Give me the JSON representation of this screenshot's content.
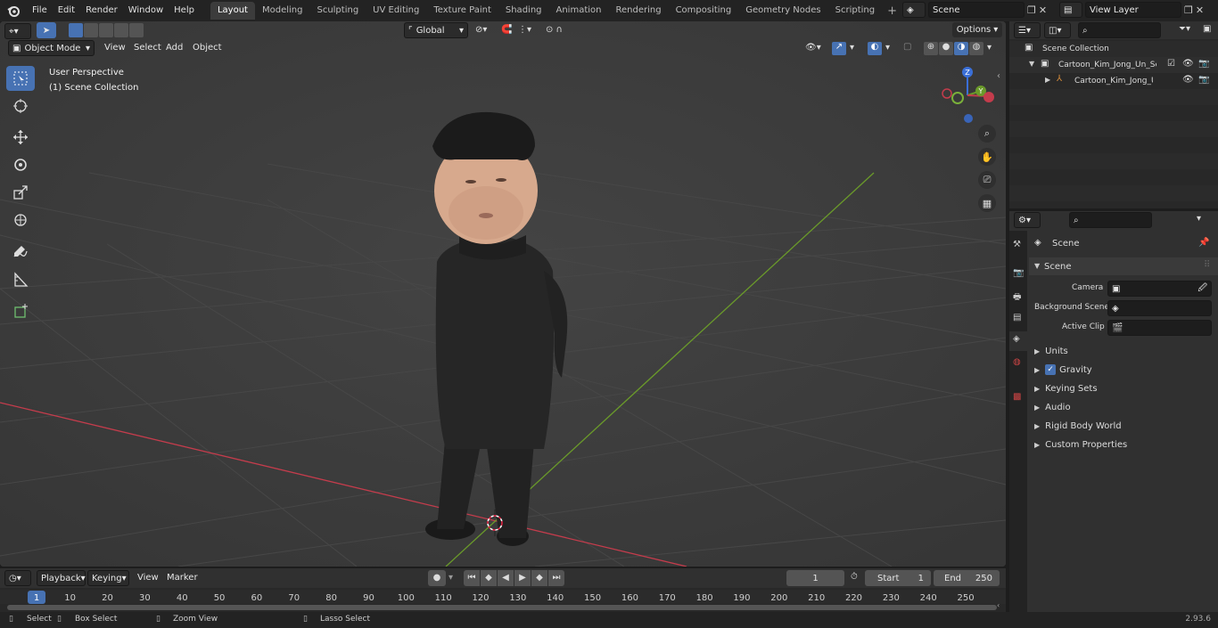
{
  "menubar": {
    "items": [
      "File",
      "Edit",
      "Render",
      "Window",
      "Help"
    ],
    "workspaces": [
      "Layout",
      "Modeling",
      "Sculpting",
      "UV Editing",
      "Texture Paint",
      "Shading",
      "Animation",
      "Rendering",
      "Compositing",
      "Geometry Nodes",
      "Scripting"
    ],
    "active_workspace": "Layout",
    "scene_name": "Scene",
    "view_layer": "View Layer"
  },
  "viewport_header": {
    "mode": "Object Mode",
    "menus": [
      "View",
      "Select",
      "Add",
      "Object"
    ],
    "orientation": "Global",
    "options": "Options"
  },
  "viewport": {
    "perspective": "User Perspective",
    "collection": "(1) Scene Collection",
    "gizmo_labels": {
      "z": "Z",
      "y": "Y"
    }
  },
  "outliner": {
    "root": "Scene Collection",
    "collection": "Cartoon_Kim_Jong_Un_Seriou",
    "object": "Cartoon_Kim_Jong_Un_Se"
  },
  "properties": {
    "context": "Scene",
    "panel": "Scene",
    "rows": [
      {
        "label": "Camera"
      },
      {
        "label": "Background Scene"
      },
      {
        "label": "Active Clip"
      }
    ],
    "subpanels": [
      "Units",
      "Gravity",
      "Keying Sets",
      "Audio",
      "Rigid Body World",
      "Custom Properties"
    ],
    "gravity_checked": true
  },
  "timeline": {
    "menus": [
      "Playback",
      "Keying",
      "View",
      "Marker"
    ],
    "current_frame": "1",
    "start_label": "Start",
    "start": "1",
    "end_label": "End",
    "end": "250",
    "ticks": [
      "1",
      "10",
      "20",
      "30",
      "40",
      "50",
      "60",
      "70",
      "80",
      "90",
      "100",
      "110",
      "120",
      "130",
      "140",
      "150",
      "160",
      "170",
      "180",
      "190",
      "200",
      "210",
      "220",
      "230",
      "240",
      "250"
    ]
  },
  "statusbar": {
    "select": "Select",
    "box_select": "Box Select",
    "zoom_view": "Zoom View",
    "lasso_select": "Lasso Select",
    "version": "2.93.6"
  },
  "colors": {
    "accent": "#4772b3",
    "x_axis": "#c43c4c",
    "y_axis": "#6a9a2a",
    "z_axis": "#3a6fd8"
  }
}
